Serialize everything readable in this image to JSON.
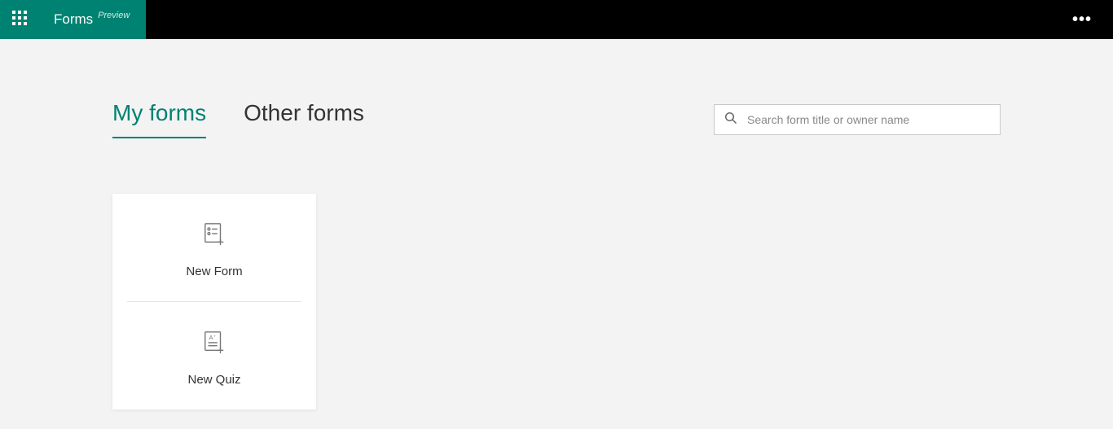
{
  "header": {
    "app_name": "Forms",
    "badge": "Preview"
  },
  "tabs": {
    "my_forms": "My forms",
    "other_forms": "Other forms"
  },
  "search": {
    "placeholder": "Search form title or owner name"
  },
  "newcard": {
    "form_label": "New Form",
    "quiz_label": "New Quiz"
  }
}
